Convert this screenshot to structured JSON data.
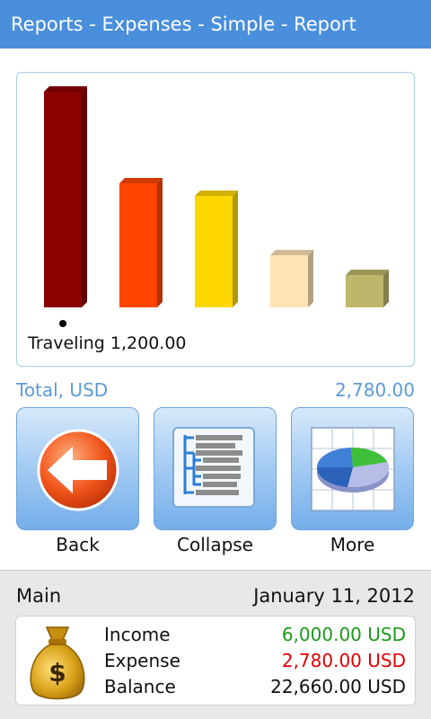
{
  "header": {
    "title": "Reports - Expenses - Simple - Report"
  },
  "chart_data": {
    "type": "bar",
    "categories": [
      "Traveling",
      "",
      "",
      "",
      ""
    ],
    "values": [
      1200,
      690,
      620,
      290,
      180
    ],
    "colors": [
      "#8b0000",
      "#ff4500",
      "#ffd700",
      "#ffe4b5",
      "#bdb76b"
    ],
    "ylim": [
      0,
      1200
    ],
    "selected_index": 0,
    "selected_label": "Traveling 1,200.00"
  },
  "total": {
    "label": "Total, USD",
    "value": "2,780.00"
  },
  "actions": {
    "back": {
      "label": "Back",
      "icon": "back-arrow-icon"
    },
    "collapse": {
      "label": "Collapse",
      "icon": "tree-list-icon"
    },
    "more": {
      "label": "More",
      "icon": "pie-chart-icon"
    }
  },
  "summary": {
    "account": "Main",
    "date": "January 11, 2012",
    "icon": "money-bag-icon",
    "rows": [
      {
        "label": "Income",
        "value": "6,000.00 USD",
        "color": "#1a9a1a"
      },
      {
        "label": "Expense",
        "value": "2,780.00 USD",
        "color": "#e00000"
      },
      {
        "label": "Balance",
        "value": "22,660.00 USD",
        "color": "#111111"
      }
    ]
  }
}
